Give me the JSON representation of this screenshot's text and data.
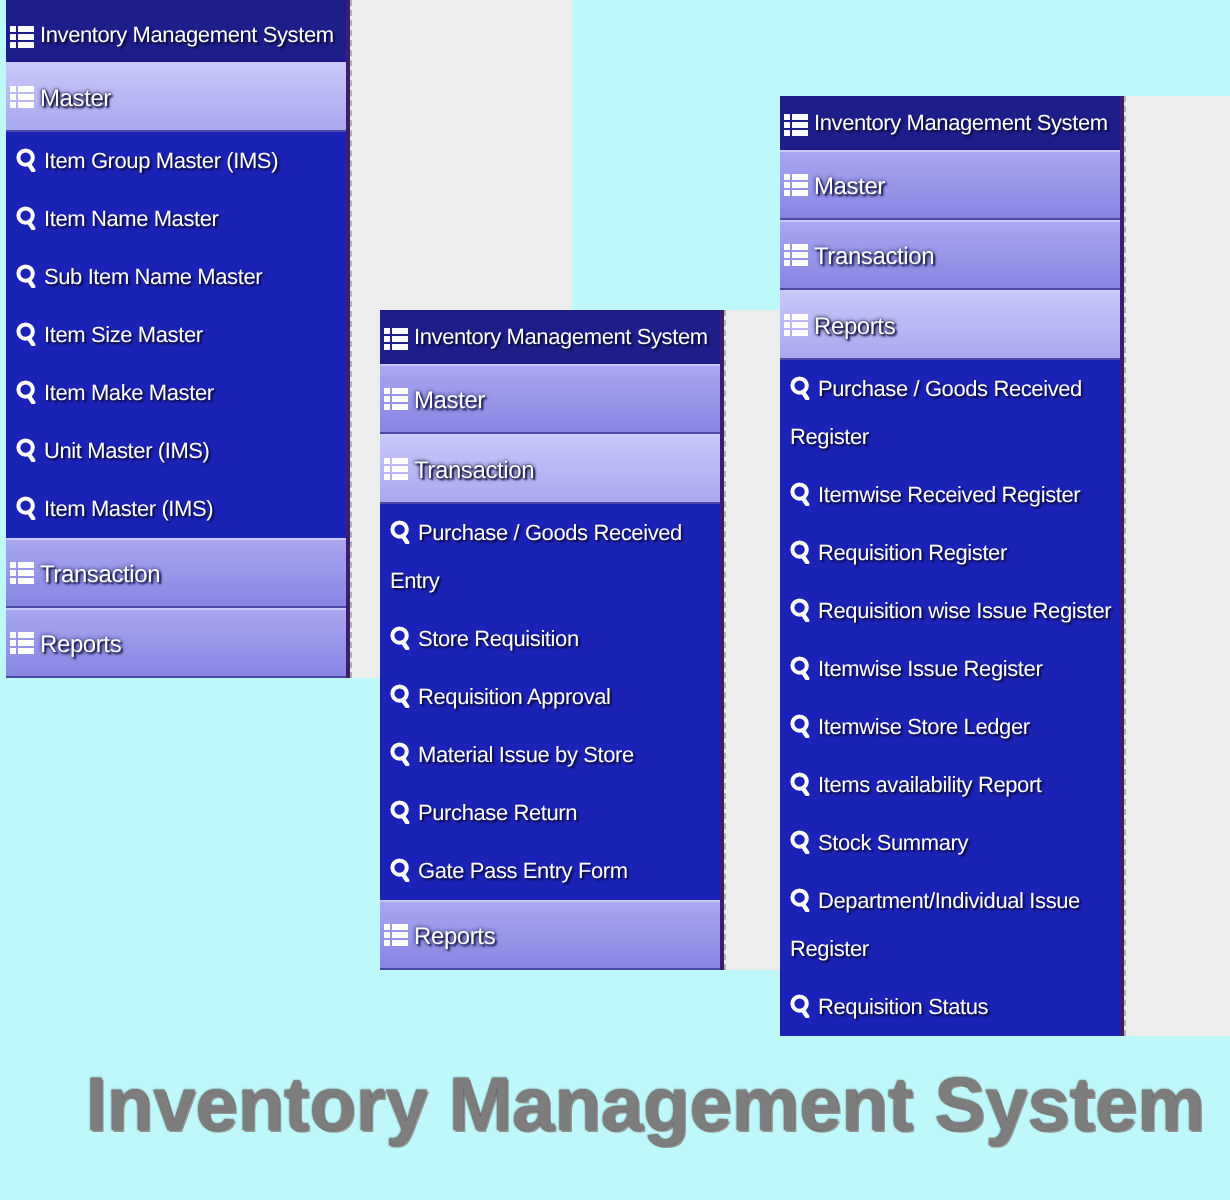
{
  "panels": [
    {
      "title": "Inventory Management System",
      "sections": [
        {
          "label": "Master",
          "expanded": true,
          "items": [
            "Item Group Master (IMS)",
            "Item Name Master",
            "Sub Item Name Master",
            "Item Size Master",
            "Item Make Master",
            "Unit Master (IMS)",
            "Item Master (IMS)"
          ]
        },
        {
          "label": "Transaction",
          "expanded": false
        },
        {
          "label": "Reports",
          "expanded": false
        }
      ]
    },
    {
      "title": "Inventory Management System",
      "sections": [
        {
          "label": "Master",
          "expanded": false
        },
        {
          "label": "Transaction",
          "expanded": true,
          "items": [
            "Purchase / Goods Received Entry",
            "Store Requisition",
            "Requisition Approval",
            "Material Issue by Store",
            "Purchase Return",
            "Gate Pass Entry Form"
          ]
        },
        {
          "label": "Reports",
          "expanded": false
        }
      ]
    },
    {
      "title": "Inventory Management System",
      "sections": [
        {
          "label": "Master",
          "expanded": false
        },
        {
          "label": "Transaction",
          "expanded": false
        },
        {
          "label": "Reports",
          "expanded": true,
          "items": [
            "Purchase / Goods Received Register",
            "Itemwise Received Register",
            "Requisition Register",
            "Requisition wise Issue Register",
            "Itemwise Issue Register",
            "Itemwise Store Ledger",
            "Items availability Report",
            "Stock Summary",
            "Department/Individual Issue Register",
            "Requisition Status"
          ]
        }
      ]
    }
  ],
  "caption": "Inventory Management System"
}
